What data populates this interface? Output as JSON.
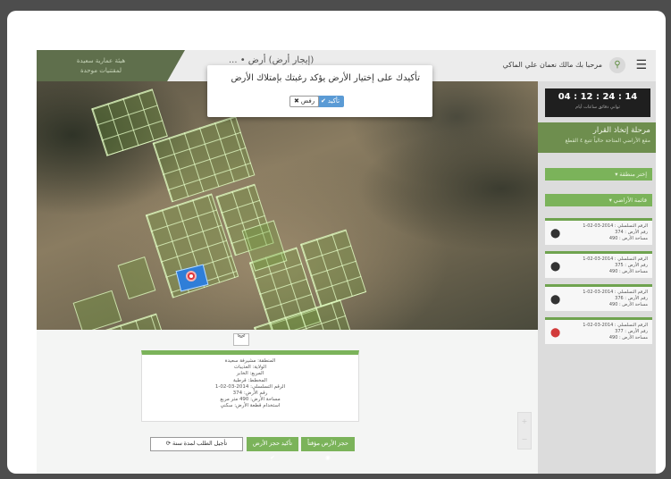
{
  "header": {
    "brand_line1": "هيئة عمارية سعيدة",
    "brand_line2": "لمقتنيات موحدة",
    "title": "(إيجار أرض) أرض • ...",
    "greeting": "مرحبا بك مالك نعمان علي الماكي",
    "user_icon": "user-pin-icon",
    "menu_icon": "hamburger-icon"
  },
  "modal": {
    "message": "تأكيدك على إختيار الأرض يؤكد رغبتك بإمتلاك الأرض",
    "confirm_label": "✔ تأكيد",
    "cancel_label": "✖ رفض"
  },
  "sidebar": {
    "countdown": "04 : 12 : 24 : 14",
    "countdown_units": "ثواني دقائق ساعات أيام",
    "stage_title": "مرحلة إتخاذ القرار",
    "stage_subtitle": "مقع الأراضي المتاحة حالياً تتبع ٤ القطع",
    "filter_button": "إختر منطقة ▾",
    "plots_button": "قائمة الأراضي ▾",
    "cards": [
      {
        "line1": "الرقم التسلسلي : 2014-03-02-1",
        "line2": "رقم الأرض : 374",
        "line3": "مساحة الأرض : 490",
        "active": false
      },
      {
        "line1": "الرقم التسلسلي : 2014-03-02-1",
        "line2": "رقم الأرض : 375",
        "line3": "مساحة الأرض : 490",
        "active": false
      },
      {
        "line1": "الرقم التسلسلي : 2014-03-02-1",
        "line2": "رقم الأرض : 376",
        "line3": "مساحة الأرض : 490",
        "active": false
      },
      {
        "line1": "الرقم التسلسلي : 2014-03-02-1",
        "line2": "رقم الأرض : 377",
        "line3": "مساحة الأرض : 490",
        "active": true
      }
    ]
  },
  "info": {
    "l1": "المنطقة: مشيرفة سعيدة",
    "l2": "الولاية: العذيبات",
    "l3": "المربع: الخابر",
    "l4": "المخطط: قرطبة",
    "l5": "الرقم التسلسلي: 2014-03-02-1",
    "l6": "رقم الأرض: 374",
    "l7": "مساحة الأرض: 490 متر مربع",
    "l8": "استخدام قطعة الأرض: سكني"
  },
  "actions": {
    "reserve": "حجز الأرض مؤقتاً ◉",
    "confirm": "تأكيد حجز الأرض ✔",
    "postpone": "تأجيل الطلب لمدة سنة ⟳"
  },
  "colors": {
    "accent": "#7bb35a",
    "stage": "#6e8e4e",
    "confirm": "#5b9bd5",
    "pin": "#e0353b"
  }
}
